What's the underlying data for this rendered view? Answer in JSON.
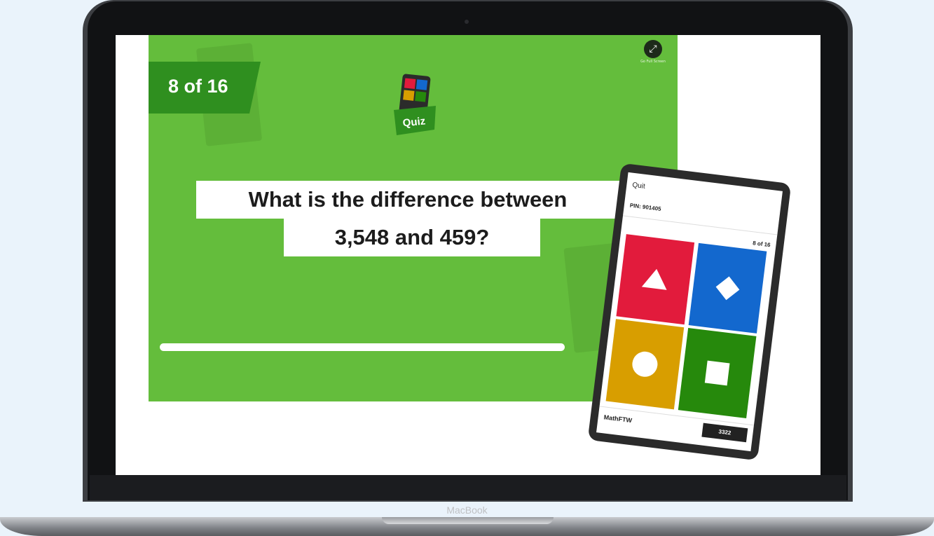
{
  "slide": {
    "counter": "8 of 16",
    "logo_label": "Quiz",
    "fullscreen_label": "Go Full Screen",
    "question_line1": "What is the difference between",
    "question_line2": "3,548 and 459?",
    "timer_progress": 1.0
  },
  "phone": {
    "quit_label": "Quit",
    "pin": "PIN: 901405",
    "counter": "8 of 16",
    "answers": [
      {
        "shape": "triangle",
        "color": "#e21b3c"
      },
      {
        "shape": "diamond",
        "color": "#1368ce"
      },
      {
        "shape": "circle",
        "color": "#d89e00"
      },
      {
        "shape": "square",
        "color": "#26890c"
      }
    ],
    "username": "MathFTW",
    "score": "3322"
  },
  "laptop": {
    "brand": "MacBook"
  },
  "colors": {
    "slide_green": "#64bd3c",
    "counter_green": "#2f8f1f"
  }
}
